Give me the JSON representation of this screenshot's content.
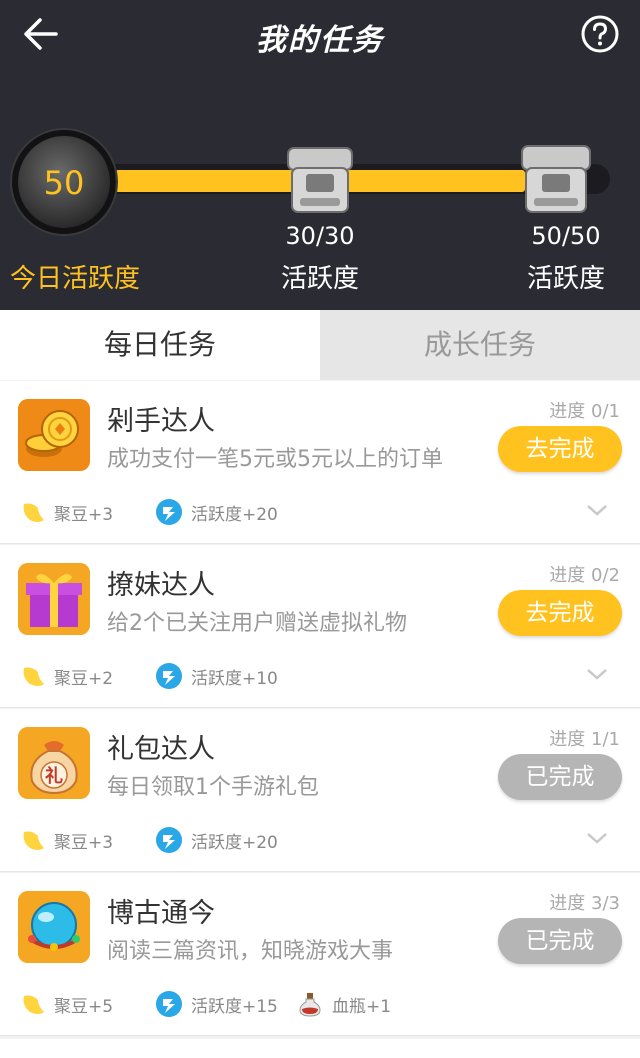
{
  "header": {
    "title": "我的任务",
    "back_icon": "back-arrow-icon",
    "help_icon": "help-circle-icon",
    "today": {
      "value": "50",
      "label": "今日活跃度"
    },
    "progress_fraction": 0.82,
    "milestones": [
      {
        "count": "30/30",
        "label": "活跃度",
        "icon": "chest-icon"
      },
      {
        "count": "50/50",
        "label": "活跃度",
        "icon": "chest-icon"
      }
    ],
    "colors": {
      "bg": "#2b2b33",
      "accent": "#ffc21f"
    }
  },
  "tabs": [
    {
      "label": "每日任务",
      "active": true
    },
    {
      "label": "成长任务",
      "active": false
    }
  ],
  "tasks": [
    {
      "name": "剁手达人",
      "desc": "成功支付一笔5元或5元以上的订单",
      "progress": "进度 0/1",
      "button": "去完成",
      "done": false,
      "icon": "coins-icon",
      "rewards": [
        {
          "icon": "bean-icon",
          "text": "聚豆+3"
        },
        {
          "icon": "activity-icon",
          "text": "活跃度+20"
        }
      ]
    },
    {
      "name": "撩妹达人",
      "desc": "给2个已关注用户赠送虚拟礼物",
      "progress": "进度 0/2",
      "button": "去完成",
      "done": false,
      "icon": "gift-box-icon",
      "rewards": [
        {
          "icon": "bean-icon",
          "text": "聚豆+2"
        },
        {
          "icon": "activity-icon",
          "text": "活跃度+10"
        }
      ]
    },
    {
      "name": "礼包达人",
      "desc": "每日领取1个手游礼包",
      "progress": "进度 1/1",
      "button": "已完成",
      "done": true,
      "icon": "gift-bag-icon",
      "bag_char": "礼",
      "rewards": [
        {
          "icon": "bean-icon",
          "text": "聚豆+3"
        },
        {
          "icon": "activity-icon",
          "text": "活跃度+20"
        }
      ]
    },
    {
      "name": "博古通今",
      "desc": "阅读三篇资讯，知晓游戏大事",
      "progress": "进度 3/3",
      "button": "已完成",
      "done": true,
      "icon": "crystal-ball-icon",
      "rewards": [
        {
          "icon": "bean-icon",
          "text": "聚豆+5"
        },
        {
          "icon": "activity-icon",
          "text": "活跃度+15"
        },
        {
          "icon": "potion-icon",
          "text": "血瓶+1"
        }
      ]
    }
  ]
}
